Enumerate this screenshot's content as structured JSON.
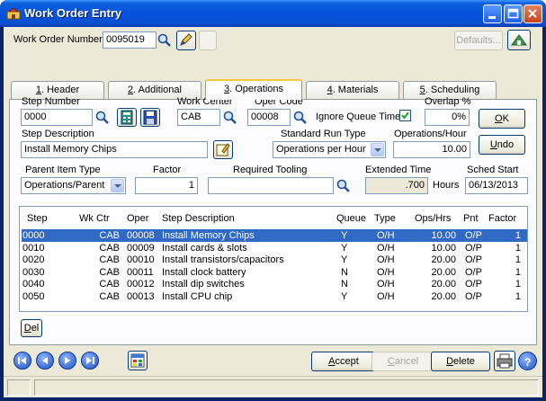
{
  "window": {
    "title": "Work Order Entry"
  },
  "header": {
    "wo_number_label": "Work Order Number",
    "wo_number_value": "0095019",
    "defaults_label": "Defaults..."
  },
  "tabs": [
    {
      "num": "1",
      "label": ". Header"
    },
    {
      "num": "2",
      "label": ". Additional"
    },
    {
      "num": "3",
      "label": ". Operations"
    },
    {
      "num": "4",
      "label": ". Materials"
    },
    {
      "num": "5",
      "label": ". Scheduling"
    }
  ],
  "form": {
    "step_number_label": "Step Number",
    "step_number_value": "0000",
    "work_center_label": "Work Center",
    "work_center_value": "CAB",
    "oper_code_label": "Oper Code",
    "oper_code_value": "00008",
    "ignore_queue_label": "Ignore Queue Time",
    "ignore_queue_checked": true,
    "overlap_label": "Overlap %",
    "overlap_value": "0%",
    "step_desc_label": "Step Description",
    "step_desc_value": "Install Memory Chips",
    "std_run_type_label": "Standard Run Type",
    "std_run_type_value": "Operations per Hour",
    "ops_hour_label": "Operations/Hour",
    "ops_hour_value": "10.00",
    "parent_item_type_label": "Parent Item Type",
    "parent_item_type_value": "Operations/Parent",
    "factor_label": "Factor",
    "factor_value": "1",
    "required_tooling_label": "Required Tooling",
    "required_tooling_value": "",
    "extended_time_label": "Extended Time",
    "extended_time_value": ".700",
    "hours_label": "Hours",
    "sched_start_label": "Sched Start",
    "sched_start_value": "06/13/2013",
    "ok_label": "K",
    "ok_mnemonic": "O",
    "undo_label": "ndo",
    "undo_mnemonic": "U"
  },
  "grid": {
    "columns": [
      "Step",
      "Wk Ctr",
      "Oper",
      "Step Description",
      "Queue",
      "Type",
      "Ops/Hrs",
      "Pnt",
      "Factor"
    ],
    "rows": [
      [
        "0000",
        "CAB",
        "00008",
        "Install Memory Chips",
        "Y",
        "O/H",
        "10.00",
        "O/P",
        "1"
      ],
      [
        "0010",
        "CAB",
        "00009",
        "Install cards & slots",
        "Y",
        "O/H",
        "10.00",
        "O/P",
        "1"
      ],
      [
        "0020",
        "CAB",
        "00010",
        "Install transistors/capacitors",
        "Y",
        "O/H",
        "20.00",
        "O/P",
        "1"
      ],
      [
        "0030",
        "CAB",
        "00011",
        "Install clock battery",
        "N",
        "O/H",
        "20.00",
        "O/P",
        "1"
      ],
      [
        "0040",
        "CAB",
        "00012",
        "Install dip switches",
        "N",
        "O/H",
        "20.00",
        "O/P",
        "1"
      ],
      [
        "0050",
        "CAB",
        "00013",
        "Install CPU chip",
        "Y",
        "O/H",
        "20.00",
        "O/P",
        "1"
      ]
    ],
    "selected_row": 0,
    "del_mnemonic": "D",
    "del_label": "el"
  },
  "footer": {
    "accept_mnemonic": "A",
    "accept_label": "ccept",
    "cancel_mnemonic": "C",
    "cancel_label": "ancel",
    "delete_mnemonic": "D",
    "delete_label": "elete"
  },
  "icons": {
    "app": "work-order-icon",
    "lookup": "magnifier-icon",
    "calculator": "calculator-icon",
    "save": "floppy-disk-icon",
    "memo": "memo-icon",
    "printer": "printer-icon",
    "help": "help-icon"
  },
  "colors": {
    "titlebar": "#0553de",
    "selection": "#316ac5",
    "window_face": "#ece9d8",
    "tab_highlight": "#ffc83c"
  }
}
